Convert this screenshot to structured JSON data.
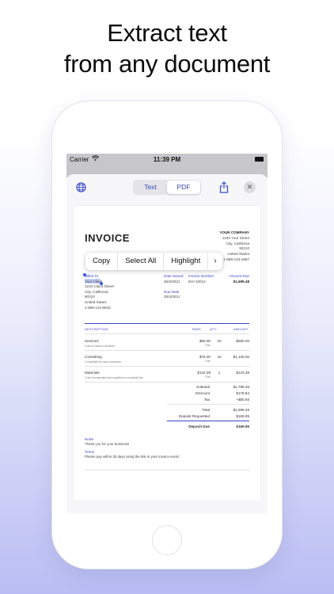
{
  "headline": {
    "line1": "Extract text",
    "line2": "from any document"
  },
  "statusbar": {
    "carrier": "Carrier",
    "time": "11:39 PM"
  },
  "toolbar": {
    "tab_text": "Text",
    "tab_pdf": "PDF",
    "close": "✕"
  },
  "context_menu": {
    "copy": "Copy",
    "select_all": "Select All",
    "highlight": "Highlight",
    "more": "›"
  },
  "invoice": {
    "title": "INVOICE",
    "company": {
      "name": "YOUR COMPANY",
      "street": "1234 Your Street",
      "city": "City, California",
      "zip": "90210",
      "country": "United States",
      "phone": "1-888-123-4567"
    },
    "bill_to": {
      "label": "Billed To",
      "name": "Your Client",
      "street": "1234 Client Street",
      "city": "City, California",
      "zip": "90210",
      "country": "United States",
      "phone": "1-888-123-8910"
    },
    "date_issued_label": "Date Issued",
    "date_issued": "26/3/2021",
    "due_date_label": "Due Date",
    "due_date": "25/4/2021",
    "invoice_number_label": "Invoice Number",
    "invoice_number": "INV-10012",
    "amount_due_label": "Amount Due",
    "amount_due": "$1,699.48",
    "columns": {
      "description": "DESCRIPTION",
      "rate": "RATE",
      "qty": "QTY",
      "amount": "AMOUNT"
    },
    "items": [
      {
        "name": "Services",
        "desc": "Cost of various services",
        "rate": "$55.00",
        "tax": "+Tax",
        "qty": "10",
        "amount": "$550.00"
      },
      {
        "name": "Consulting",
        "desc": "Consultant for your business.",
        "rate": "$75.00",
        "tax": "+Tax",
        "qty": "15",
        "amount": "$1,125.00"
      },
      {
        "name": "Materials",
        "desc": "Cost of materials and supplies to complete job.",
        "rate": "$123.39",
        "tax": "+Tax",
        "qty": "1",
        "amount": "$123.39"
      }
    ],
    "totals": {
      "subtotal_label": "Subtotal",
      "subtotal": "$1,798.39",
      "discount_label": "Discount",
      "discount": "$179.84",
      "tax_label": "Tax",
      "tax": "+$80.93",
      "total_label": "Total",
      "total": "$1,699.48",
      "deposit_requested_label": "Deposit Requested",
      "deposit_requested": "$169.95",
      "deposit_due_label": "Deposit Due",
      "deposit_due": "$169.95"
    },
    "notes_label": "Notes",
    "notes": "Thank you for your business!",
    "terms_label": "Terms",
    "terms": "Please pay within 30 days using the link in your invoice email."
  },
  "colors": {
    "accent": "#3b43c7",
    "selection": "#2f5fe0",
    "background_bottom": "#b9bdf3"
  }
}
